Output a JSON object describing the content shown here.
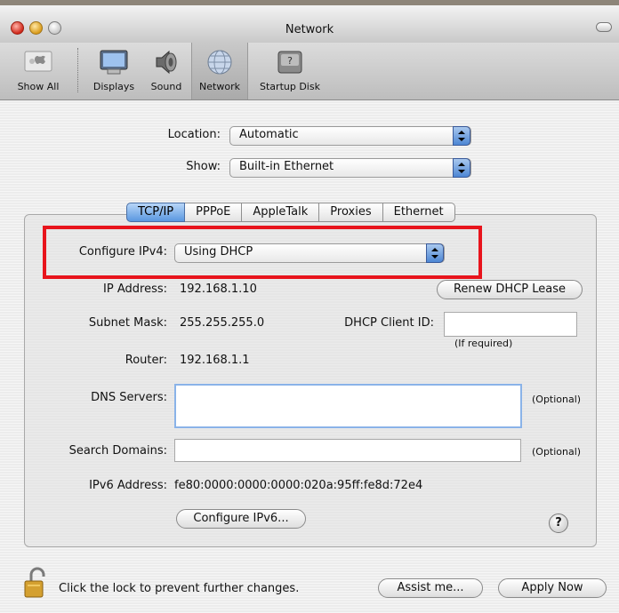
{
  "window": {
    "title": "Network"
  },
  "toolbar": {
    "items": [
      {
        "label": "Show All",
        "icon": "apple-grid-icon"
      },
      {
        "label": "Displays",
        "icon": "display-icon"
      },
      {
        "label": "Sound",
        "icon": "speaker-icon"
      },
      {
        "label": "Network",
        "icon": "network-globe-icon",
        "selected": true
      },
      {
        "label": "Startup Disk",
        "icon": "startup-disk-icon"
      }
    ]
  },
  "location": {
    "label": "Location:",
    "value": "Automatic"
  },
  "show": {
    "label": "Show:",
    "value": "Built-in Ethernet"
  },
  "tabs": [
    {
      "label": "TCP/IP",
      "active": true
    },
    {
      "label": "PPPoE"
    },
    {
      "label": "AppleTalk"
    },
    {
      "label": "Proxies"
    },
    {
      "label": "Ethernet"
    }
  ],
  "tcpip": {
    "configure_label": "Configure IPv4:",
    "configure_value": "Using DHCP",
    "ip_label": "IP Address:",
    "ip_value": "192.168.1.10",
    "renew_button": "Renew DHCP Lease",
    "subnet_label": "Subnet Mask:",
    "subnet_value": "255.255.255.0",
    "dhcp_client_label": "DHCP Client ID:",
    "dhcp_client_value": "",
    "if_required": "(If required)",
    "router_label": "Router:",
    "router_value": "192.168.1.1",
    "dns_label": "DNS Servers:",
    "dns_value": "",
    "dns_optional": "(Optional)",
    "search_label": "Search Domains:",
    "search_value": "",
    "search_optional": "(Optional)",
    "ipv6_label": "IPv6 Address:",
    "ipv6_value": "fe80:0000:0000:0000:020a:95ff:fe8d:72e4",
    "configure_ipv6_button": "Configure IPv6...",
    "help": "?"
  },
  "footer": {
    "lock_text": "Click the lock to prevent further changes.",
    "assist_button": "Assist me...",
    "apply_button": "Apply Now"
  },
  "colors": {
    "highlight": "#e8141c",
    "accent": "#5a97e0"
  }
}
